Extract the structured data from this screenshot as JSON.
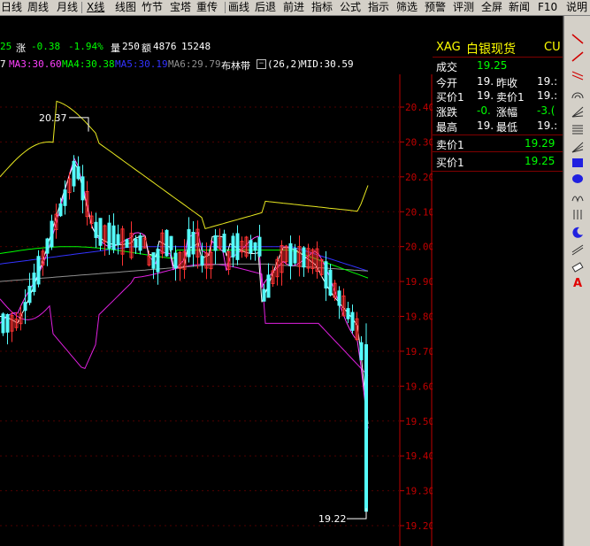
{
  "menu": {
    "items": [
      "日线",
      "周线",
      "月线",
      "X线",
      "线图",
      "竹节",
      "宝塔",
      "重传",
      "画线",
      "后退",
      "前进",
      "指标",
      "公式",
      "指示",
      "筛选",
      "预警",
      "评测",
      "全屏",
      "新闻",
      "F10",
      "说明"
    ],
    "active_index": 3
  },
  "info_bar": {
    "price_tail": "25",
    "change_label": "涨",
    "change_value": "-0.38",
    "change_pct": "-1.94%",
    "volume_label": "量",
    "volume_value": "250",
    "amount_label": "额",
    "amount_value": "4876",
    "extra_value": "15248"
  },
  "ma_bar": {
    "prefix": "7",
    "ma3": "MA3:30.60",
    "ma4": "MA4:30.38",
    "ma5": "MA5:30.19",
    "ma6": "MA6:29.79",
    "boll_name": "布林带",
    "boll_params": "(26,2)",
    "mid": "MID:30.59"
  },
  "chart_data": {
    "type": "candlestick",
    "y_ticks": [
      "20.40",
      "20.30",
      "20.20",
      "20.10",
      "20.00",
      "19.90",
      "19.80",
      "19.70",
      "19.60",
      "19.50",
      "19.40",
      "19.30",
      "19.20"
    ],
    "ylim": [
      19.18,
      20.44
    ],
    "max_label": "20.37",
    "min_label": "19.22",
    "colors": {
      "up": "#ff3232",
      "down": "#54fcfc",
      "axis": "#c00000",
      "upper_band": "#e8e820",
      "lower_band": "#e020e0",
      "mid": "#ffffff"
    }
  },
  "quote_panel": {
    "symbol": "XAG",
    "name": "白银现货",
    "tail": "CU",
    "rows": [
      {
        "l1": "成交",
        "v1": "19.25",
        "l2": "",
        "v2": ""
      },
      {
        "l1": "今开",
        "v1": "19.",
        "l2": "昨收",
        "v2": "19.:"
      },
      {
        "l1": "买价1",
        "v1": "19.",
        "l2": "卖价1",
        "v2": "19.:"
      },
      {
        "l1": "涨跌",
        "v1": "-0.",
        "l2": "涨幅",
        "v2": "-3.("
      },
      {
        "l1": "最高",
        "v1": "19.",
        "l2": "最低",
        "v2": "19.:"
      }
    ],
    "sell1_label": "卖价1",
    "sell1_value": "19.29",
    "buy1_label": "买价1",
    "buy1_value": "19.25"
  },
  "toolbar": {
    "tools": [
      "line-tool-icon",
      "ray-tool-icon",
      "parallel-tool-icon",
      "arc-tool-icon",
      "fan-tool-icon",
      "fib-tool-icon",
      "speed-tool-icon",
      "rect-tool-icon",
      "ellipse-tool-icon",
      "cycle-tool-icon",
      "period-tool-icon",
      "moon-tool-icon",
      "channel-tool-icon",
      "eraser-tool-icon",
      "text-tool-icon"
    ],
    "text_tool_label": "A"
  }
}
